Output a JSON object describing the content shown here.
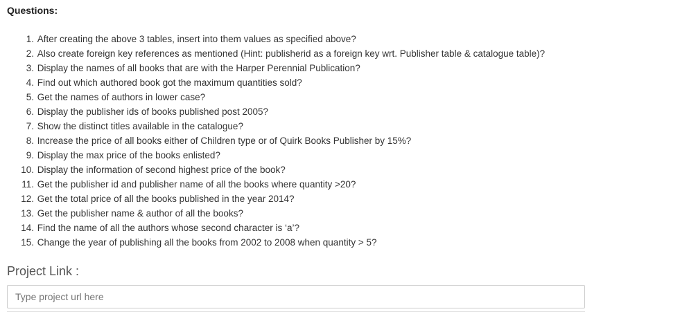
{
  "questions_heading": "Questions:",
  "questions": [
    {
      "num": "1.",
      "text": "After creating the above 3 tables, insert into them values as specified above?"
    },
    {
      "num": "2.",
      "text": "Also create foreign key references as mentioned (Hint: publisherid as a foreign key wrt. Publisher table & catalogue table)?"
    },
    {
      "num": "3.",
      "text": "Display the names of all books that are with the Harper Perennial Publication?"
    },
    {
      "num": "4.",
      "text": "Find out which authored book got the maximum quantities sold?"
    },
    {
      "num": "5.",
      "text": "Get the names of authors in lower case?"
    },
    {
      "num": "6.",
      "text": "Display the publisher ids of books published post 2005?"
    },
    {
      "num": "7.",
      "text": "Show the distinct titles available in the catalogue?"
    },
    {
      "num": "8.",
      "text": "Increase the price of all books either of Children type or of Quirk Books Publisher by 15%?"
    },
    {
      "num": "9.",
      "text": "Display the max price of the books enlisted?"
    },
    {
      "num": "10.",
      "text": "Display the information of second highest price of the book?"
    },
    {
      "num": "11.",
      "text": "Get the publisher id and publisher name of all the books where quantity >20?"
    },
    {
      "num": "12.",
      "text": "Get the total price of all the books published in the year 2014?"
    },
    {
      "num": "13.",
      "text": "Get the publisher name & author of all the books?"
    },
    {
      "num": "14.",
      "text": "Find the name of all the authors whose second character is ‘a’?"
    },
    {
      "num": "15.",
      "text": "Change the year of publishing all the books from 2002 to 2008 when quantity > 5?"
    }
  ],
  "project_link": {
    "label": "Project Link :",
    "placeholder": "Type project url here",
    "value": ""
  }
}
